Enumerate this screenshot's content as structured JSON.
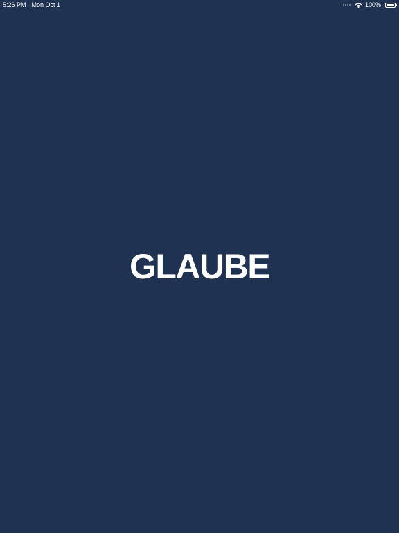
{
  "status_bar": {
    "time": "5:26 PM",
    "date": "Mon Oct 1",
    "battery_percent": "100%",
    "battery_level": 1.0
  },
  "splash": {
    "logo_text": "GLAUBE"
  },
  "colors": {
    "background": "#203251",
    "text": "#ffffff"
  },
  "icons": [
    "signal-icon",
    "wifi-icon",
    "battery-icon"
  ]
}
